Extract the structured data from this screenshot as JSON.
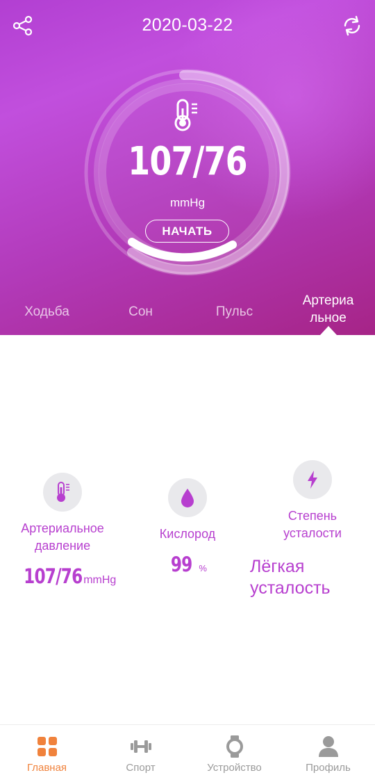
{
  "header": {
    "date": "2020-03-22",
    "share_icon": "share-icon",
    "sync_icon": "refresh-icon"
  },
  "gauge": {
    "icon": "thermometer-icon",
    "value": "107/76",
    "unit": "mmHg",
    "start_label": "НАЧАТЬ",
    "progress_fraction": 0.62
  },
  "tabs": [
    {
      "label": "Ходьба",
      "active": false
    },
    {
      "label": "Сон",
      "active": false
    },
    {
      "label": "Пульс",
      "active": false
    },
    {
      "label_line1": "Артериа",
      "label_line2": "льное",
      "active": true
    }
  ],
  "stats": {
    "pressure": {
      "icon": "thermometer-icon",
      "label_line1": "Артериальное",
      "label_line2": "давление",
      "value": "107/76",
      "unit": "mmHg"
    },
    "oxygen": {
      "icon": "water-drop-icon",
      "label": "Кислород",
      "value": "99",
      "unit": "%"
    },
    "fatigue": {
      "icon": "lightning-icon",
      "label_line1": "Степень",
      "label_line2": "усталости",
      "value_line1": "Лёгкая",
      "value_line2": "усталость"
    }
  },
  "nav": [
    {
      "label": "Главная",
      "icon": "home-grid-icon",
      "active": true
    },
    {
      "label": "Спорт",
      "icon": "dumbbell-icon",
      "active": false
    },
    {
      "label": "Устройство",
      "icon": "watch-icon",
      "active": false
    },
    {
      "label": "Профиль",
      "icon": "person-icon",
      "active": false
    }
  ],
  "colors": {
    "accent_purple": "#b73fcf",
    "nav_active": "#f0823c",
    "nav_inactive": "#9a9a9a"
  }
}
